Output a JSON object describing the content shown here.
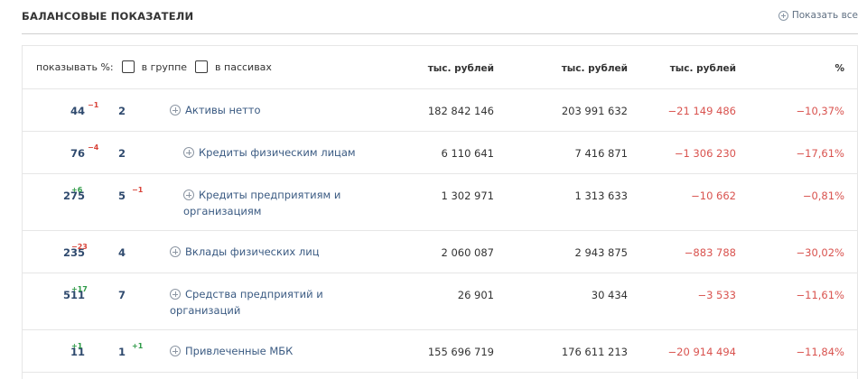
{
  "header": {
    "title": "БАЛАНСОВЫЕ ПОКАЗАТЕЛИ",
    "show_all": "Показать все"
  },
  "options": {
    "label": "показывать %:",
    "group_label": "в группе",
    "passive_label": "в пассивах"
  },
  "columns": [
    "тыс. рублей",
    "тыс. рублей",
    "тыс. рублей",
    "%"
  ],
  "rows": [
    {
      "rank": "44",
      "rank_delta": "−1",
      "group_rank": "2",
      "group_delta": "",
      "name1": "Активы нетто",
      "name2": "",
      "v1": "182 842 146",
      "v2": "203 991 632",
      "diff": "−21 149 486",
      "pct": "−10,37%"
    },
    {
      "rank": "76",
      "rank_delta": "−4",
      "group_rank": "2",
      "group_delta": "",
      "name1": "Кредиты физическим лицам",
      "name2": "",
      "v1": "6 110 641",
      "v2": "7 416 871",
      "diff": "−1 306 230",
      "pct": "−17,61%"
    },
    {
      "rank": "275",
      "rank_delta": "+6",
      "group_rank": "5",
      "group_delta": "−1",
      "name1": "Кредиты предприятиям и",
      "name2": "организациям",
      "v1": "1 302 971",
      "v2": "1 313 633",
      "diff": "−10 662",
      "pct": "−0,81%"
    },
    {
      "rank": "235",
      "rank_delta": "−23",
      "group_rank": "4",
      "group_delta": "",
      "name1": "Вклады физических лиц",
      "name2": "",
      "v1": "2 060 087",
      "v2": "2 943 875",
      "diff": "−883 788",
      "pct": "−30,02%"
    },
    {
      "rank": "511",
      "rank_delta": "+17",
      "group_rank": "7",
      "group_delta": "",
      "name1": "Средства предприятий и",
      "name2": "организаций",
      "v1": "26 901",
      "v2": "30 434",
      "diff": "−3 533",
      "pct": "−11,61%"
    },
    {
      "rank": "11",
      "rank_delta": "+1",
      "group_rank": "1",
      "group_delta": "+1",
      "name1": "Привлеченные МБК",
      "name2": "",
      "v1": "155 696 719",
      "v2": "176 611 213",
      "diff": "−20 914 494",
      "pct": "−11,84%"
    }
  ]
}
